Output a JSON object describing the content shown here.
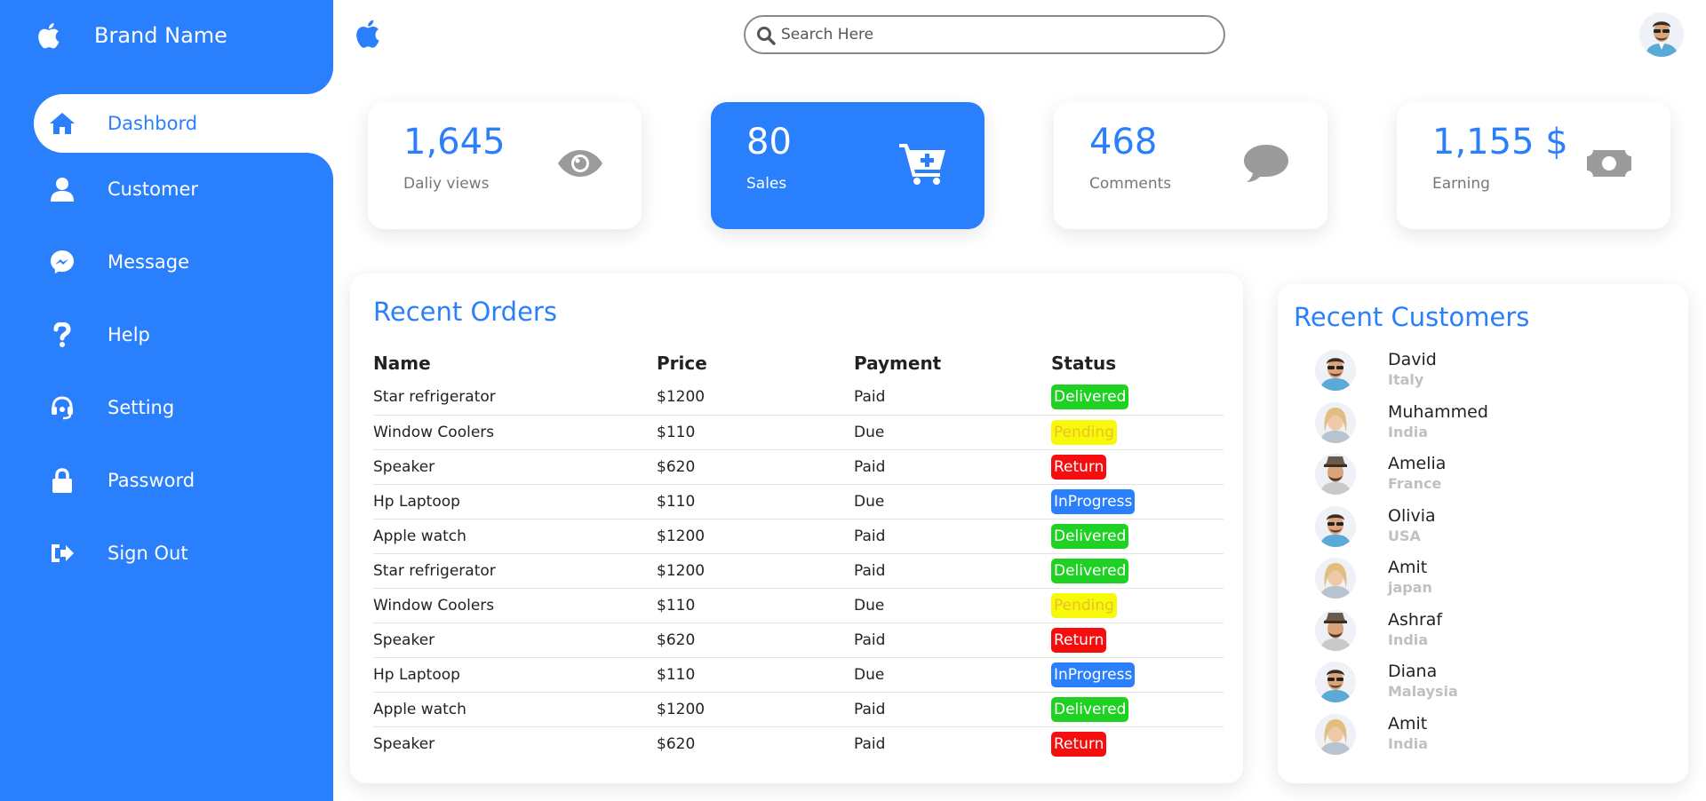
{
  "brand": {
    "name": "Brand Name"
  },
  "nav": [
    {
      "label": "Dashbord",
      "icon": "home-icon",
      "active": true
    },
    {
      "label": "Customer",
      "icon": "user-icon"
    },
    {
      "label": "Message",
      "icon": "messenger-icon"
    },
    {
      "label": "Help",
      "icon": "question-icon"
    },
    {
      "label": "Setting",
      "icon": "headset-icon"
    },
    {
      "label": "Password",
      "icon": "lock-icon"
    },
    {
      "label": "Sign Out",
      "icon": "sign-out-icon"
    }
  ],
  "search": {
    "placeholder": "Search Here",
    "value": ""
  },
  "cards": [
    {
      "value": "1,645",
      "label": "Daliy views",
      "icon": "eye-icon"
    },
    {
      "value": "80",
      "label": "Sales",
      "icon": "cart-plus-icon",
      "highlight": true
    },
    {
      "value": "468",
      "label": "Comments",
      "icon": "comment-icon"
    },
    {
      "value": "1,155 $",
      "label": "Earning",
      "icon": "money-icon"
    }
  ],
  "orders": {
    "title": "Recent Orders",
    "columns": [
      "Name",
      "Price",
      "Payment",
      "Status"
    ],
    "rows": [
      {
        "name": "Star refrigerator",
        "price": "$1200",
        "payment": "Paid",
        "status": "Delivered"
      },
      {
        "name": "Window Coolers",
        "price": "$110",
        "payment": "Due",
        "status": "Pending"
      },
      {
        "name": "Speaker",
        "price": "$620",
        "payment": "Paid",
        "status": "Return"
      },
      {
        "name": "Hp Laptoop",
        "price": "$110",
        "payment": "Due",
        "status": "InProgress"
      },
      {
        "name": "Apple watch",
        "price": "$1200",
        "payment": "Paid",
        "status": "Delivered"
      },
      {
        "name": "Star refrigerator",
        "price": "$1200",
        "payment": "Paid",
        "status": "Delivered"
      },
      {
        "name": "Window Coolers",
        "price": "$110",
        "payment": "Due",
        "status": "Pending"
      },
      {
        "name": "Speaker",
        "price": "$620",
        "payment": "Paid",
        "status": "Return"
      },
      {
        "name": "Hp Laptoop",
        "price": "$110",
        "payment": "Due",
        "status": "InProgress"
      },
      {
        "name": "Apple watch",
        "price": "$1200",
        "payment": "Paid",
        "status": "Delivered"
      },
      {
        "name": "Speaker",
        "price": "$620",
        "payment": "Paid",
        "status": "Return"
      }
    ]
  },
  "customers": {
    "title": "Recent Customers",
    "items": [
      {
        "name": "David",
        "country": "Italy",
        "avatar": "man-sunglasses"
      },
      {
        "name": "Muhammed",
        "country": "India",
        "avatar": "woman-blonde"
      },
      {
        "name": "Amelia",
        "country": "France",
        "avatar": "man-hat"
      },
      {
        "name": "Olivia",
        "country": "USA",
        "avatar": "man-sunglasses"
      },
      {
        "name": "Amit",
        "country": "japan",
        "avatar": "woman-blonde"
      },
      {
        "name": "Ashraf",
        "country": "India",
        "avatar": "man-hat"
      },
      {
        "name": "Diana",
        "country": "Malaysia",
        "avatar": "man-sunglasses"
      },
      {
        "name": "Amit",
        "country": "India",
        "avatar": "woman-blonde"
      }
    ]
  },
  "colors": {
    "primary": "#2a7ffd",
    "delivered": "#1fd123",
    "pending": "#f6f90a",
    "return": "#f60d0d",
    "inprogress": "#2a7ffd"
  }
}
